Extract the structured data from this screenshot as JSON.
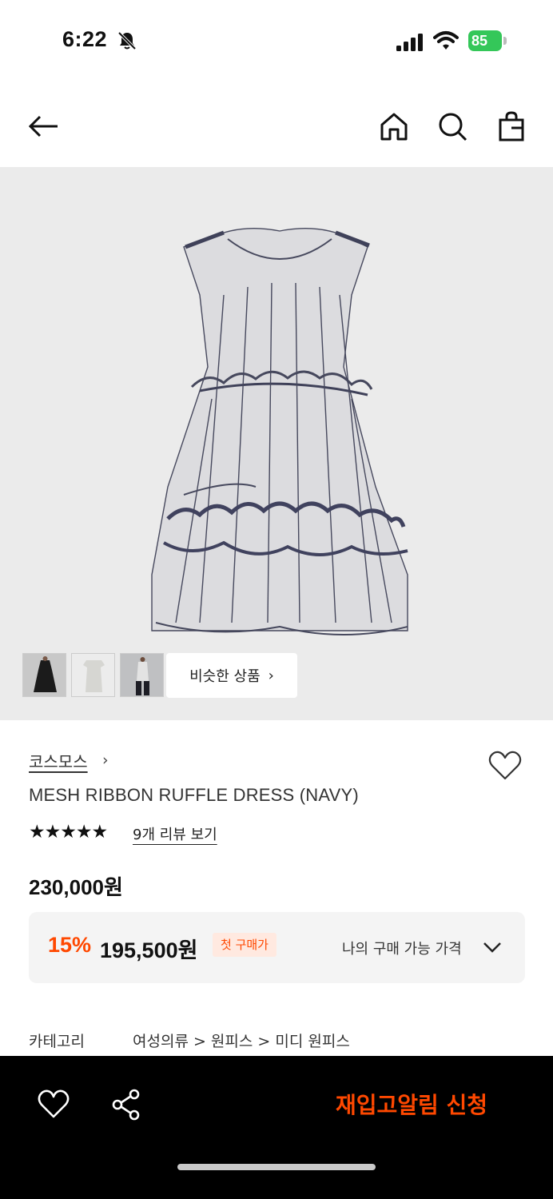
{
  "status": {
    "time": "6:22",
    "battery": "85"
  },
  "product": {
    "similar_label": "비슷한 상품",
    "similar_chevron": "›",
    "brand": "코스모스",
    "brand_chevron": "›",
    "name": "MESH RIBBON RUFFLE DRESS (NAVY)",
    "rating_stars": "★★★★★",
    "rating": 5,
    "reviews_label": "9개 리뷰 보기",
    "price": "230,000원",
    "discount_rate": "15%",
    "discount_price": "195,500원",
    "first_purchase_badge": "첫 구매가",
    "my_price_label": "나의 구매 가능 가격",
    "category_label": "카테고리",
    "category_path": "여성의류 > 원피스 > 미디 원피스"
  },
  "bottom_bar": {
    "restock_label": "재입고알림 신청"
  },
  "colors": {
    "accent": "#ff4800",
    "image_bg": "#ebebeb",
    "bottom_bar": "#000000"
  }
}
